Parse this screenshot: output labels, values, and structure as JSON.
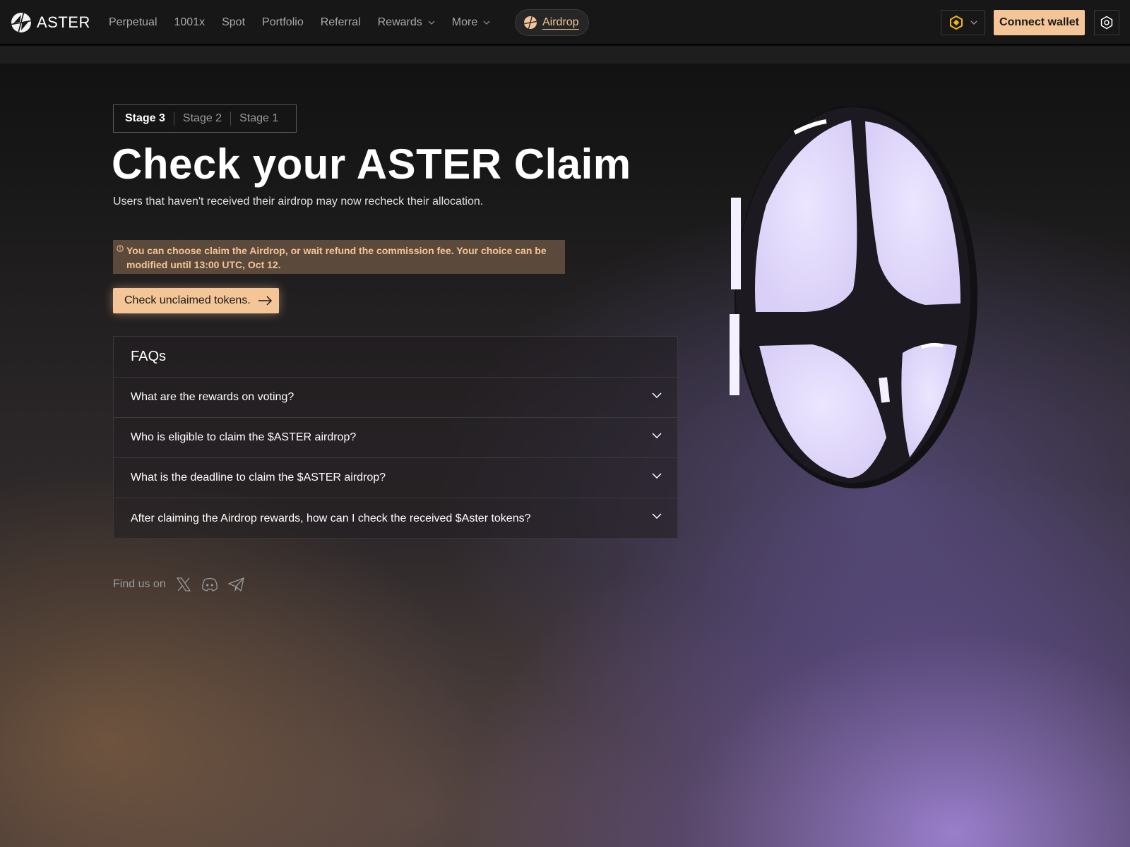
{
  "brand": {
    "name": "ASTER"
  },
  "nav": {
    "items": [
      {
        "label": "Perpetual",
        "dropdown": false
      },
      {
        "label": "1001x",
        "dropdown": false
      },
      {
        "label": "Spot",
        "dropdown": false
      },
      {
        "label": "Portfolio",
        "dropdown": false
      },
      {
        "label": "Referral",
        "dropdown": false
      },
      {
        "label": "Rewards",
        "dropdown": true
      },
      {
        "label": "More",
        "dropdown": true
      }
    ],
    "airdrop_label": "Airdrop"
  },
  "header_actions": {
    "chain_icon": "bnb-chain-icon",
    "connect_label": "Connect wallet",
    "settings_icon": "settings-icon"
  },
  "stages": {
    "tabs": [
      "Stage 3",
      "Stage 2",
      "Stage 1"
    ],
    "active": "Stage 3"
  },
  "hero": {
    "title": "Check your ASTER Claim",
    "subtitle": "Users that haven't received their airdrop may now recheck their allocation."
  },
  "notice": {
    "icon": "info-icon",
    "text": "You can choose claim the Airdrop, or wait refund the commission fee. Your choice can be modified until 13:00 UTC, Oct 12."
  },
  "cta": {
    "label": "Check unclaimed tokens.",
    "icon": "arrow-right-icon"
  },
  "faq": {
    "title": "FAQs",
    "items": [
      "What are the rewards on voting?",
      "Who is eligible to claim the $ASTER airdrop?",
      "What is the deadline to claim the $ASTER airdrop?",
      "After claiming the Airdrop rewards, how can I check the received $Aster tokens?"
    ]
  },
  "social": {
    "label": "Find us on",
    "icons": [
      "x-icon",
      "discord-icon",
      "telegram-icon"
    ]
  },
  "colors": {
    "accent": "#f4c596",
    "background": "#121212",
    "notice_bg": "#5b4a3c",
    "emblem_fill": "#e4dcfb"
  }
}
